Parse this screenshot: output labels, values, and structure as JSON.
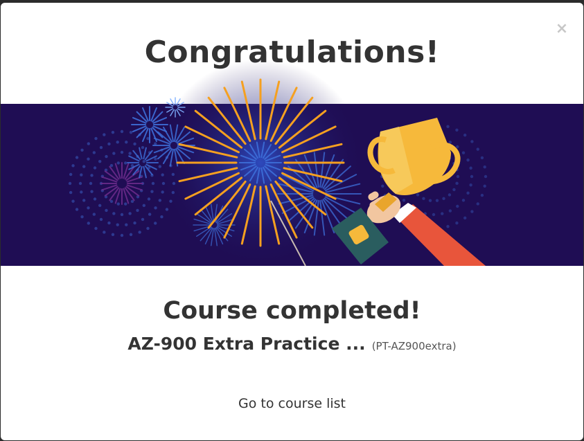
{
  "modal": {
    "close_glyph": "×",
    "title": "Congratulations!",
    "subtitle": "Course completed!",
    "course_name": "AZ-900 Extra Practice ...",
    "course_code": "(PT-AZ900extra)",
    "link_label": "Go to course list"
  },
  "illustration": {
    "icons": [
      "fireworks-icon",
      "trophy-icon"
    ],
    "colors": {
      "banner_bg": "#1f0d54",
      "firework_orange": "#f5a020",
      "firework_blue": "#3d6fd9",
      "firework_purple": "#6a2a8a",
      "trophy_gold": "#f6b93b",
      "sleeve_red": "#e8553b",
      "handle_green": "#2a5d5f",
      "hand_skin": "#f2c6a0"
    }
  }
}
